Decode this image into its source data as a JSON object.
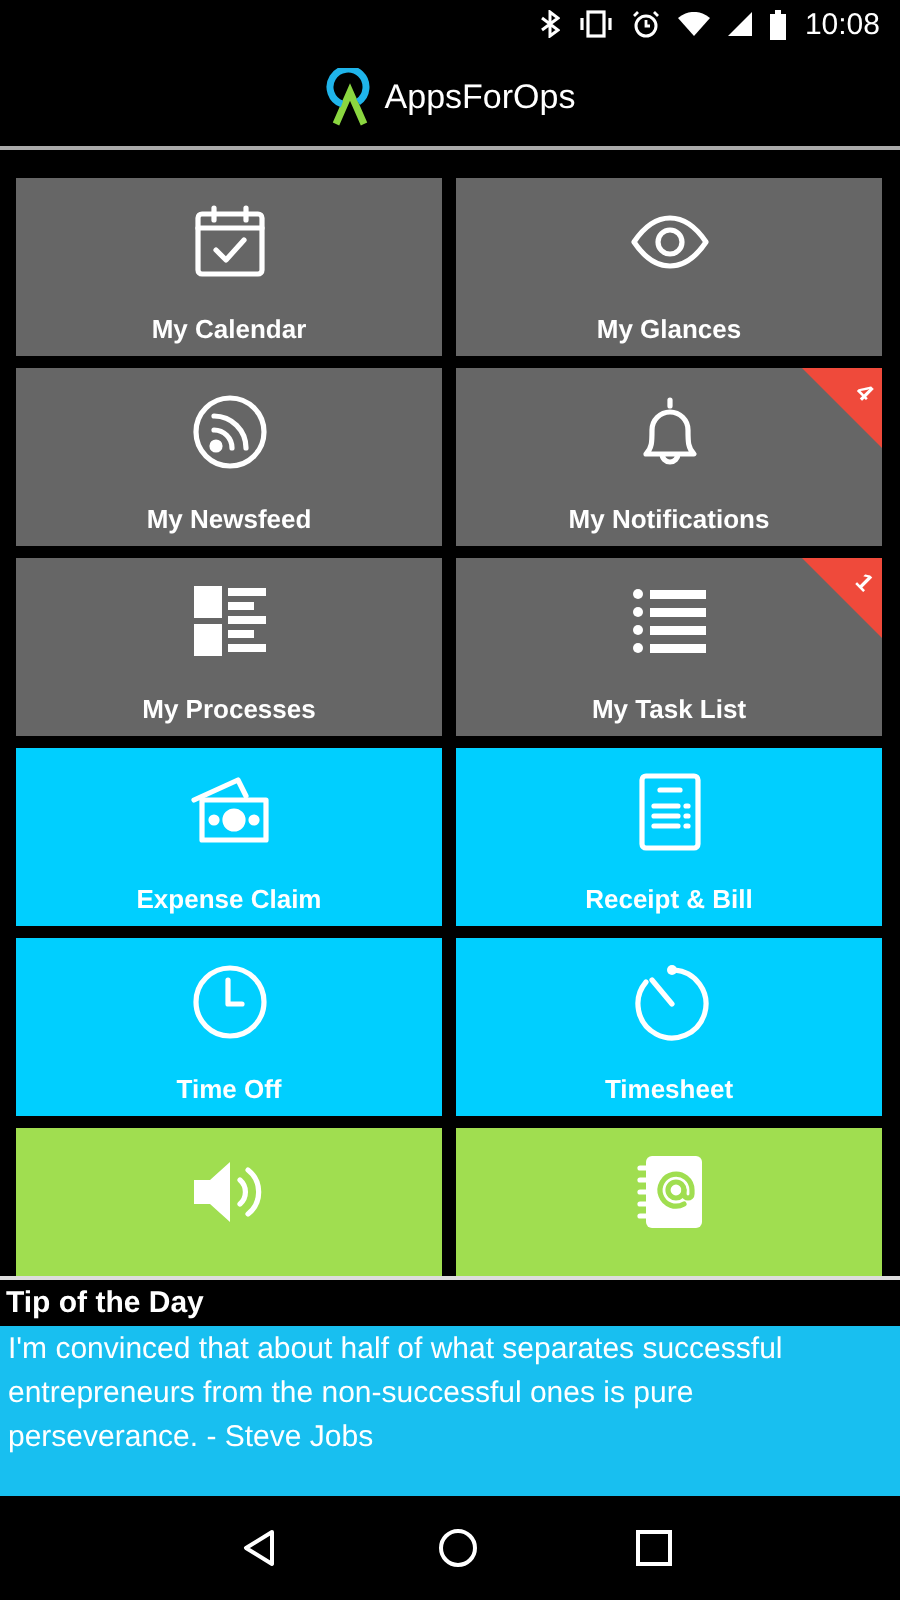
{
  "status_bar": {
    "time": "10:08"
  },
  "header": {
    "app_name": "AppsForOps"
  },
  "tiles": [
    {
      "kind": "calendar",
      "label": "My Calendar",
      "color": "#666666"
    },
    {
      "kind": "eye",
      "label": "My Glances",
      "color": "#666666"
    },
    {
      "kind": "feed",
      "label": "My Newsfeed",
      "color": "#666666"
    },
    {
      "kind": "bell",
      "label": "My Notifications",
      "color": "#666666",
      "badge": "4"
    },
    {
      "kind": "processes",
      "label": "My Processes",
      "color": "#666666"
    },
    {
      "kind": "list",
      "label": "My Task List",
      "color": "#666666",
      "badge": "1"
    },
    {
      "kind": "money",
      "label": "Expense Claim",
      "color": "#00cfff"
    },
    {
      "kind": "receipt",
      "label": "Receipt & Bill",
      "color": "#00cfff"
    },
    {
      "kind": "clock",
      "label": "Time Off",
      "color": "#00cfff"
    },
    {
      "kind": "timer",
      "label": "Timesheet",
      "color": "#00cfff"
    },
    {
      "kind": "speaker",
      "color": "#a0de50"
    },
    {
      "kind": "contacts",
      "color": "#a0de50"
    }
  ],
  "tip": {
    "title": "Tip of the Day",
    "text": "I'm convinced that about half of what separates successful entrepreneurs from the non-successful ones is pure perseverance. - Steve Jobs"
  }
}
